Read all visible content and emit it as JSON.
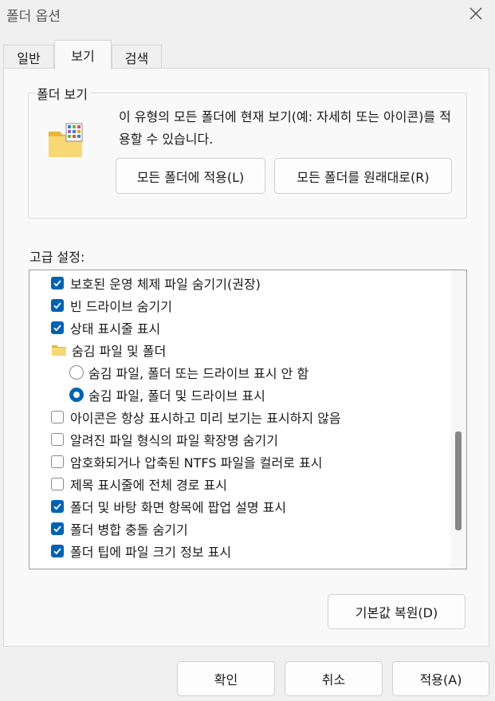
{
  "window": {
    "title": "폴더 옵션"
  },
  "tabs": [
    {
      "label": "일반",
      "active": false
    },
    {
      "label": "보기",
      "active": true
    },
    {
      "label": "검색",
      "active": false
    }
  ],
  "folder_views": {
    "legend": "폴더 보기",
    "description": "이 유형의 모든 폴더에 현재 보기(예: 자세히 또는 아이콘)를 적용할 수 있습니다.",
    "apply_all_label": "모든 폴더에 적용(L)",
    "reset_all_label": "모든 폴더를 원래대로(R)"
  },
  "advanced": {
    "label": "고급 설정:",
    "items": [
      {
        "type": "checkbox",
        "checked": true,
        "label": "보호된 운영 체제 파일 숨기기(권장)"
      },
      {
        "type": "checkbox",
        "checked": true,
        "label": "빈 드라이브 숨기기"
      },
      {
        "type": "checkbox",
        "checked": true,
        "label": "상태 표시줄 표시"
      },
      {
        "type": "folder",
        "label": "숨김 파일 및 폴더"
      },
      {
        "type": "radio",
        "checked": false,
        "label": "숨김 파일, 폴더 또는 드라이브 표시 안 함"
      },
      {
        "type": "radio",
        "checked": true,
        "label": "숨김 파일, 폴더 및 드라이브 표시"
      },
      {
        "type": "checkbox",
        "checked": false,
        "label": "아이콘은 항상 표시하고 미리 보기는 표시하지 않음"
      },
      {
        "type": "checkbox",
        "checked": false,
        "label": "알려진 파일 형식의 파일 확장명 숨기기"
      },
      {
        "type": "checkbox",
        "checked": false,
        "label": "암호화되거나 압축된 NTFS 파일을 컬러로 표시"
      },
      {
        "type": "checkbox",
        "checked": false,
        "label": "제목 표시줄에 전체 경로 표시"
      },
      {
        "type": "checkbox",
        "checked": true,
        "label": "폴더 및 바탕 화면 항목에 팝업 설명 표시"
      },
      {
        "type": "checkbox",
        "checked": true,
        "label": "폴더 병합 충돌 숨기기"
      },
      {
        "type": "checkbox",
        "checked": true,
        "label": "폴더 팁에 파일 크기 정보 표시"
      }
    ],
    "restore_defaults_label": "기본값 복원(D)"
  },
  "footer": {
    "ok_label": "확인",
    "cancel_label": "취소",
    "apply_label": "적용(A)"
  },
  "colors": {
    "accent": "#0063b1"
  }
}
